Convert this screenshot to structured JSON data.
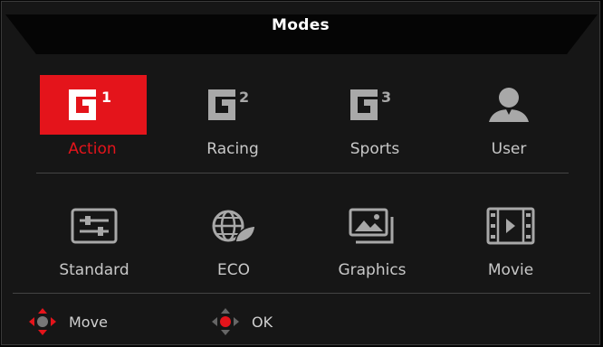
{
  "title": "Modes",
  "modes_row1": [
    {
      "label": "Action",
      "icon": "g1-icon",
      "selected": true
    },
    {
      "label": "Racing",
      "icon": "g2-icon",
      "selected": false
    },
    {
      "label": "Sports",
      "icon": "g3-icon",
      "selected": false
    },
    {
      "label": "User",
      "icon": "user-icon",
      "selected": false
    }
  ],
  "modes_row2": [
    {
      "label": "Standard",
      "icon": "sliders-icon"
    },
    {
      "label": "ECO",
      "icon": "eco-globe-icon"
    },
    {
      "label": "Graphics",
      "icon": "pictures-icon"
    },
    {
      "label": "Movie",
      "icon": "film-icon"
    }
  ],
  "footer": {
    "move_label": "Move",
    "ok_label": "OK"
  },
  "colors": {
    "accent": "#e4141b",
    "background": "#161616",
    "text": "#c8c8c8"
  }
}
